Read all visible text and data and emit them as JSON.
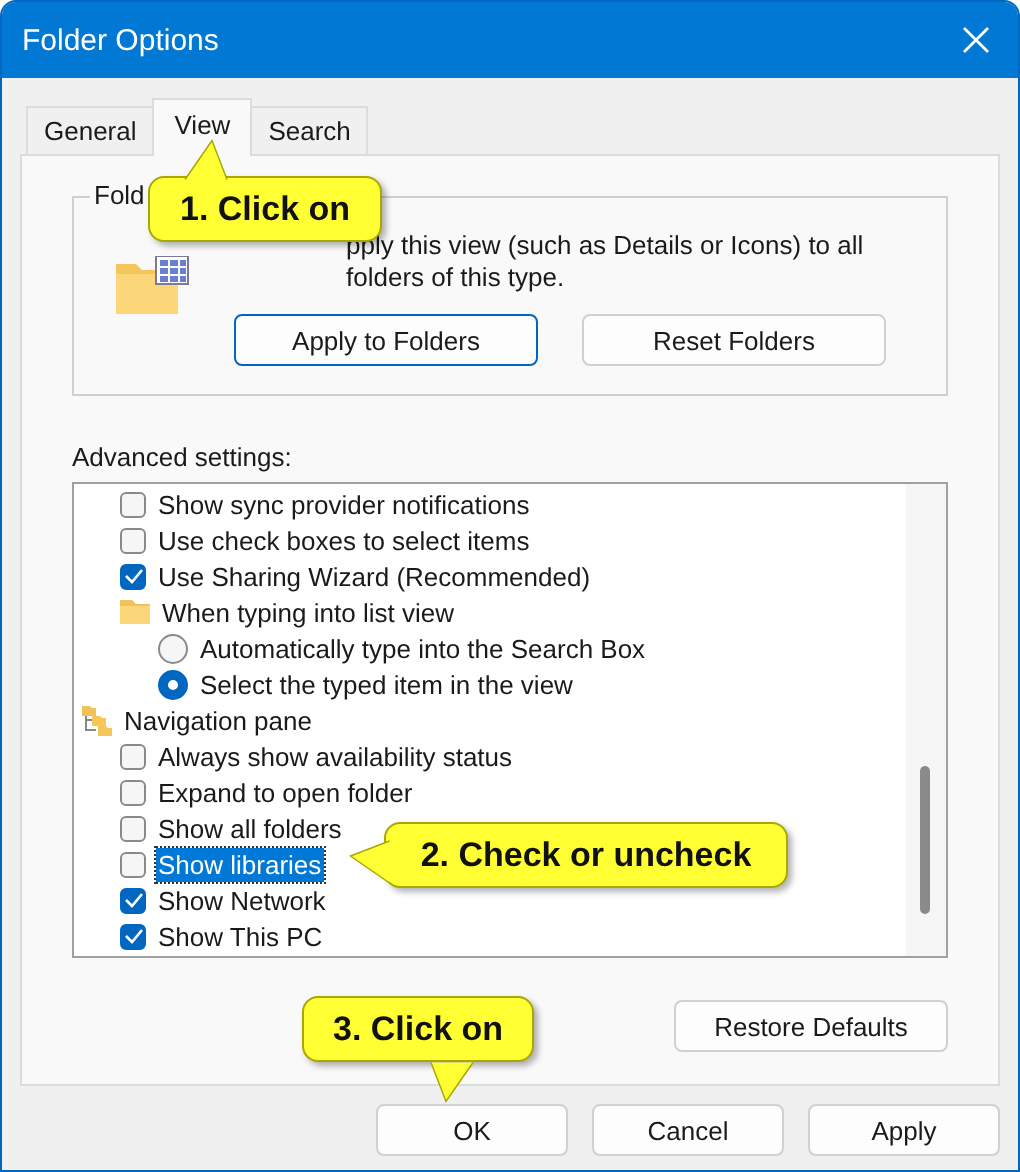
{
  "window": {
    "title": "Folder Options"
  },
  "tabs": [
    {
      "label": "General",
      "selected": false
    },
    {
      "label": "View",
      "selected": true
    },
    {
      "label": "Search",
      "selected": false
    }
  ],
  "folder_views": {
    "label": "Fold",
    "description": "pply this view (such as Details or Icons) to all folders of this type.",
    "buttons": [
      {
        "label": "Apply to Folders",
        "focused": true
      },
      {
        "label": "Reset Folders",
        "focused": false
      }
    ]
  },
  "advanced_settings": {
    "label": "Advanced settings:",
    "items": [
      {
        "kind": "group",
        "children": [
          {
            "kind": "checkbox",
            "label": "Show sync provider notifications",
            "checked": false,
            "selected": false
          },
          {
            "kind": "checkbox",
            "label": "Use check boxes to select items",
            "checked": false,
            "selected": false
          },
          {
            "kind": "checkbox",
            "label": "Use Sharing Wizard (Recommended)",
            "checked": true,
            "selected": false
          },
          {
            "kind": "folder",
            "label": "When typing into list view",
            "selected": false,
            "children": [
              {
                "kind": "radio",
                "label": "Automatically type into the Search Box",
                "checked": false,
                "selected": false
              },
              {
                "kind": "radio",
                "label": "Select the typed item in the view",
                "checked": true,
                "selected": false
              }
            ]
          }
        ]
      },
      {
        "kind": "pane",
        "label": "Navigation pane",
        "selected": false,
        "children": [
          {
            "kind": "checkbox",
            "label": "Always show availability status",
            "checked": false,
            "selected": false
          },
          {
            "kind": "checkbox",
            "label": "Expand to open folder",
            "checked": false,
            "selected": false
          },
          {
            "kind": "checkbox",
            "label": "Show all folders",
            "checked": false,
            "selected": false
          },
          {
            "kind": "checkbox",
            "label": "Show libraries",
            "checked": false,
            "selected": true
          },
          {
            "kind": "checkbox",
            "label": "Show Network",
            "checked": true,
            "selected": false
          },
          {
            "kind": "checkbox",
            "label": "Show This PC",
            "checked": true,
            "selected": false
          }
        ]
      }
    ]
  },
  "restore_button": "Restore Defaults",
  "buttons": [
    "OK",
    "Cancel",
    "Apply"
  ],
  "callouts": [
    {
      "text": "1. Click on"
    },
    {
      "text": "2. Check or uncheck"
    },
    {
      "text": "3. Click on"
    }
  ]
}
